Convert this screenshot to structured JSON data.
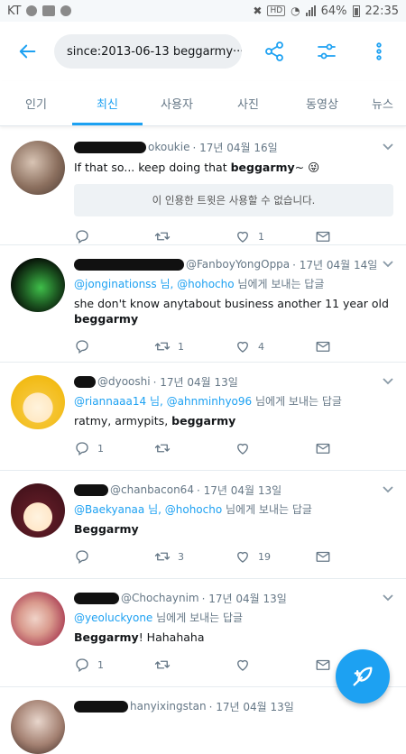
{
  "status_bar": {
    "carrier": "KT",
    "network": "HD",
    "battery": "64%",
    "time": "22:35"
  },
  "search": {
    "query": "since:2013-06-13 beggarmy···"
  },
  "tabs": [
    {
      "label": "인기"
    },
    {
      "label": "최신"
    },
    {
      "label": "사용자"
    },
    {
      "label": "사진"
    },
    {
      "label": "동영상"
    },
    {
      "label": "뉴스"
    }
  ],
  "tweets": [
    {
      "handle": "okoukie",
      "date": "· 17년 04월 16일",
      "body_text": "If that so... keep doing that ",
      "body_bold": "beggarmy",
      "body_suffix": "~ 😜",
      "quote_notice": "이 인용한 트윗은 사용할 수 없습니다.",
      "replies": "",
      "retweets": "",
      "likes": "1"
    },
    {
      "handle": "@FanboyYongOppa",
      "date": "· 17년 04월 14일",
      "reply_mentions": "@jonginationss 님, @hohocho",
      "reply_suffix": " 님에게 보내는 답글",
      "body_text": "she don't know anytabout business another 11 year old",
      "body_bold": "beggarmy",
      "replies": "",
      "retweets": "1",
      "likes": "4"
    },
    {
      "handle": "@dyooshi",
      "date": "· 17년 04월 13일",
      "reply_mentions": "@riannaaa14 님, @ahnminhyo96",
      "reply_suffix": " 님에게 보내는 답글",
      "body_text": "ratmy, armypits, ",
      "body_bold": "beggarmy",
      "replies": "1",
      "retweets": "",
      "likes": ""
    },
    {
      "handle": "@chanbacon64",
      "date": "· 17년 04월 13일",
      "reply_mentions": "@Baekyanaa 님, @hohocho",
      "reply_suffix": " 님에게 보내는 답글",
      "body_text": "",
      "body_bold": "Beggarmy",
      "replies": "",
      "retweets": "3",
      "likes": "19"
    },
    {
      "handle": "@Chochaynim",
      "date": "· 17년 04월 13일",
      "reply_mentions": "@yeoluckyone",
      "reply_suffix": " 님에게 보내는 답글",
      "body_text": "",
      "body_bold": "Beggarmy",
      "body_suffix": "! Hahahaha",
      "replies": "1",
      "retweets": "",
      "likes": ""
    },
    {
      "handle": "hanyixingstan",
      "date": "· 17년 04월 13일"
    }
  ],
  "colors": {
    "accent": "#1da1f2",
    "text": "#14171a",
    "muted": "#657786"
  }
}
